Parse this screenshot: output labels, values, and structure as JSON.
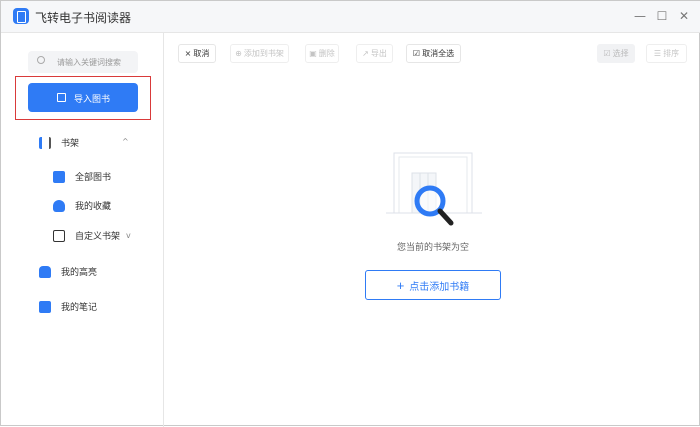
{
  "app": {
    "title": "飞转电子书阅读器"
  },
  "window_controls": {
    "minimize": "—",
    "maximize": "☐",
    "close": "✕"
  },
  "sidebar": {
    "search_placeholder": "请输入关键词搜索",
    "import_label": "导入图书",
    "shelf": {
      "label": "书架",
      "chevron": "^"
    },
    "items": [
      {
        "label": "全部图书"
      },
      {
        "label": "我的收藏"
      },
      {
        "label": "自定义书架",
        "chevron": "v"
      }
    ],
    "highlights": "我的高亮",
    "notes": "我的笔记"
  },
  "toolbar": {
    "cancel": "取消",
    "add_to_shelf": "添加到书架",
    "delete": "删除",
    "export": "导出",
    "deselect_all": "取消全选",
    "select": "选择",
    "sort": "排序"
  },
  "main": {
    "empty_text": "您当前的书架为空",
    "add_button": "点击添加书籍",
    "add_icon": "+"
  },
  "colors": {
    "accent": "#2f7bf5",
    "highlight_box": "#d93a3a"
  }
}
